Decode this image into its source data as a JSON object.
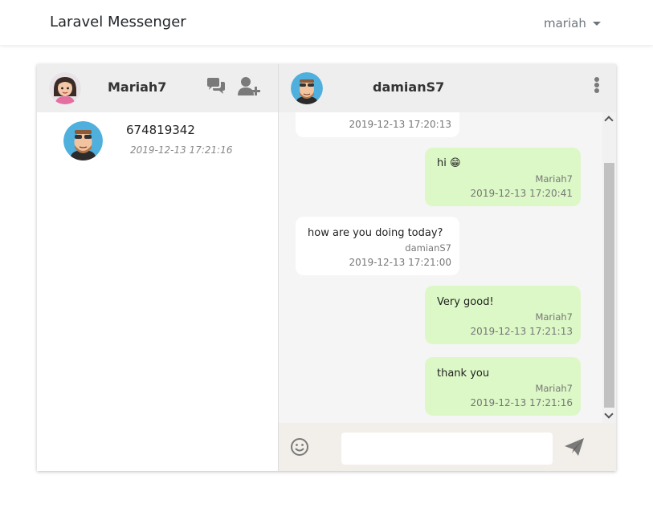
{
  "app": {
    "brand": "Laravel Messenger",
    "user_menu": "mariah"
  },
  "sidebar": {
    "me": {
      "name": "Mariah7"
    },
    "contacts": [
      {
        "name": "674819342",
        "time": "2019-12-13 17:21:16"
      }
    ]
  },
  "chat": {
    "peer": {
      "name": "damianS7"
    },
    "messages": [
      {
        "direction": "incoming",
        "text": "",
        "author": "",
        "time": "2019-12-13 17:20:13"
      },
      {
        "direction": "outgoing",
        "text": "hi 😁",
        "author": "Mariah7",
        "time": "2019-12-13 17:20:41"
      },
      {
        "direction": "incoming",
        "text": "how are you doing today?",
        "author": "damianS7",
        "time": "2019-12-13 17:21:00"
      },
      {
        "direction": "outgoing",
        "text": "Very good!",
        "author": "Mariah7",
        "time": "2019-12-13 17:21:13"
      },
      {
        "direction": "outgoing",
        "text": "thank you",
        "author": "Mariah7",
        "time": "2019-12-13 17:21:16"
      }
    ],
    "composer": {
      "value": "",
      "placeholder": ""
    }
  },
  "icons": {
    "chat": "chat-bubbles-icon",
    "add_user": "add-user-icon",
    "menu": "kebab-menu-icon",
    "emoji": "smiley-icon",
    "send": "send-icon"
  },
  "colors": {
    "outgoing_bubble": "#dcf8c6",
    "incoming_bubble": "#ffffff",
    "header_bg": "#eeeeee",
    "composer_bg": "#f2efea",
    "icon_gray": "#7a7a7a"
  }
}
